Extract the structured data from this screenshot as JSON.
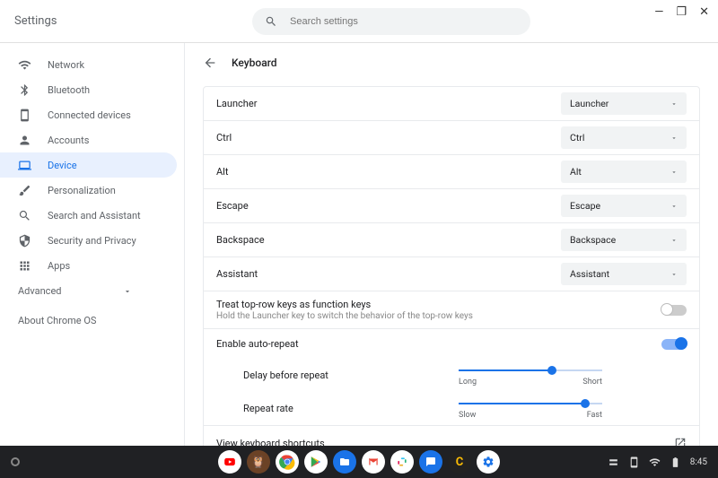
{
  "window": {
    "title": "Settings"
  },
  "search": {
    "placeholder": "Search settings"
  },
  "sidebar": {
    "items": [
      {
        "label": "Network"
      },
      {
        "label": "Bluetooth"
      },
      {
        "label": "Connected devices"
      },
      {
        "label": "Accounts"
      },
      {
        "label": "Device"
      },
      {
        "label": "Personalization"
      },
      {
        "label": "Search and Assistant"
      },
      {
        "label": "Security and Privacy"
      },
      {
        "label": "Apps"
      }
    ],
    "advanced": "Advanced",
    "about": "About Chrome OS"
  },
  "page": {
    "title": "Keyboard",
    "keymaps": [
      {
        "label": "Launcher",
        "value": "Launcher"
      },
      {
        "label": "Ctrl",
        "value": "Ctrl"
      },
      {
        "label": "Alt",
        "value": "Alt"
      },
      {
        "label": "Escape",
        "value": "Escape"
      },
      {
        "label": "Backspace",
        "value": "Backspace"
      },
      {
        "label": "Assistant",
        "value": "Assistant"
      }
    ],
    "function_keys": {
      "title": "Treat top-row keys as function keys",
      "sub": "Hold the Launcher key to switch the behavior of the top-row keys"
    },
    "auto_repeat": {
      "title": "Enable auto-repeat",
      "delay": {
        "label": "Delay before repeat",
        "left": "Long",
        "right": "Short",
        "value": 65
      },
      "rate": {
        "label": "Repeat rate",
        "left": "Slow",
        "right": "Fast",
        "value": 88
      }
    },
    "shortcuts": "View keyboard shortcuts"
  },
  "shelf": {
    "time": "8:45"
  }
}
